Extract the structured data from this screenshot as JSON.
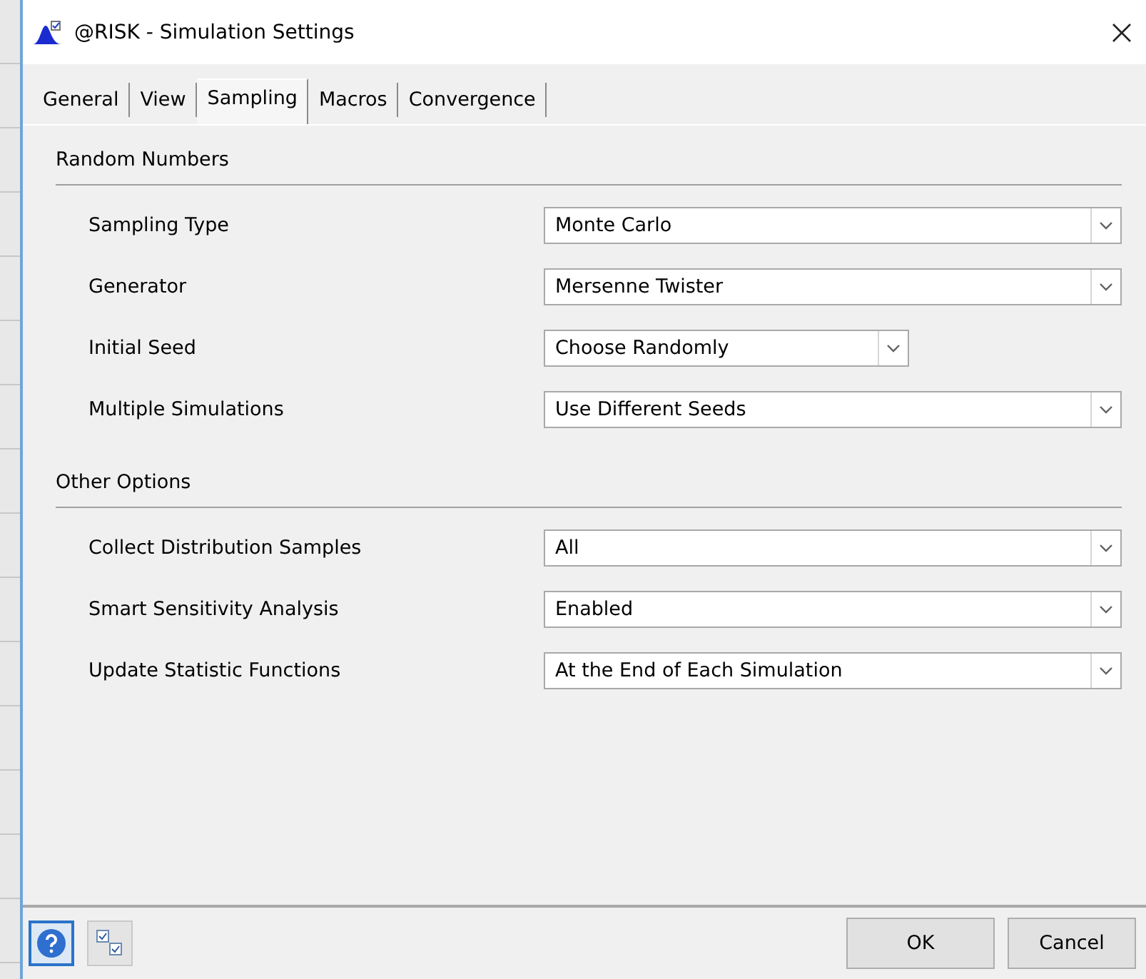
{
  "window": {
    "title": "@RISK - Simulation Settings"
  },
  "tabs": [
    {
      "label": "General",
      "selected": false
    },
    {
      "label": "View",
      "selected": false
    },
    {
      "label": "Sampling",
      "selected": true
    },
    {
      "label": "Macros",
      "selected": false
    },
    {
      "label": "Convergence",
      "selected": false
    }
  ],
  "sections": [
    {
      "title": "Random Numbers",
      "rows": [
        {
          "label": "Sampling Type",
          "value": "Monte Carlo",
          "kind": "wide"
        },
        {
          "label": "Generator",
          "value": "Mersenne Twister",
          "kind": "wide"
        },
        {
          "label": "Initial Seed",
          "value": "Choose Randomly",
          "kind": "narrow"
        },
        {
          "label": "Multiple Simulations",
          "value": "Use Different Seeds",
          "kind": "wide"
        }
      ]
    },
    {
      "title": "Other Options",
      "rows": [
        {
          "label": "Collect Distribution Samples",
          "value": "All",
          "kind": "wide"
        },
        {
          "label": "Smart Sensitivity Analysis",
          "value": "Enabled",
          "kind": "wide"
        },
        {
          "label": "Update Statistic Functions",
          "value": "At the End of Each Simulation",
          "kind": "wide"
        }
      ]
    }
  ],
  "buttons": [
    "OK",
    "Cancel"
  ]
}
